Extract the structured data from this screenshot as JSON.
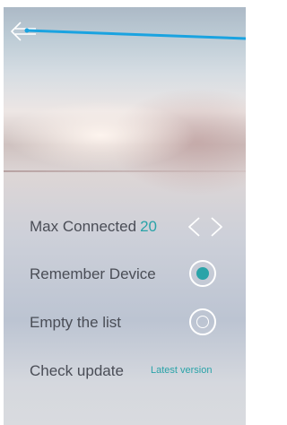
{
  "header": {
    "back_icon": "back-arrow-icon"
  },
  "settings": {
    "max_connected": {
      "label": "Max Connected",
      "value": "20",
      "decrement_icon": "chevron-left-icon",
      "increment_icon": "chevron-right-icon"
    },
    "remember_device": {
      "label": "Remember Device",
      "checked": true
    },
    "empty_list": {
      "label": "Empty the list",
      "checked": false
    },
    "check_update": {
      "label": "Check update",
      "status": "Latest version"
    }
  },
  "colors": {
    "accent": "#2aa3a8",
    "label": "#4a4d56",
    "control_outline": "#ffffff",
    "cursor_stroke": "#1aa3e0"
  }
}
